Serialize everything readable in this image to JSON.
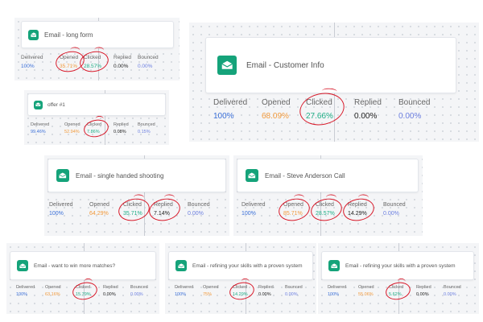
{
  "labels": {
    "delivered": "Delivered",
    "opened": "Opened",
    "clicked": "Clicked",
    "replied": "Replied",
    "bounced": "Bounced"
  },
  "cards": [
    {
      "title": "Email - long form",
      "delivered": "100%",
      "opened": "35.71%",
      "clicked": "28.57%",
      "replied": "0.00%",
      "bounced": "0.00%"
    },
    {
      "title": "offer #1",
      "delivered": "99.46%",
      "opened": "52.94%",
      "clicked": "7.86%",
      "replied": "0.08%",
      "bounced": "0.15%"
    },
    {
      "title": "Email - Customer Info",
      "delivered": "100%",
      "opened": "68.09%",
      "clicked": "27.66%",
      "replied": "0.00%",
      "bounced": "0.00%"
    },
    {
      "title": "Email - single handed shooting",
      "delivered": "100%",
      "opened": "64.29%",
      "clicked": "35.71%",
      "replied": "7.14%",
      "bounced": "0.00%"
    },
    {
      "title": "Email - Steve Anderson Call",
      "delivered": "100%",
      "opened": "85.71%",
      "clicked": "28.57%",
      "replied": "14.29%",
      "bounced": "0.00%"
    },
    {
      "title": "Email - want to win more matches?",
      "delivered": "100%",
      "opened": "63.16%",
      "clicked": "15.79%",
      "replied": "0.00%",
      "bounced": "0.00%"
    },
    {
      "title": "Email - refining your skills with a proven system",
      "delivered": "100%",
      "opened": "75%",
      "clicked": "14.29%",
      "replied": "0.00%",
      "bounced": "0.00%"
    },
    {
      "title": "Email - refining your skills with a proven system",
      "delivered": "100%",
      "opened": "55.06%",
      "clicked": "5.62%",
      "replied": "0.00%",
      "bounced": "0.00%"
    }
  ],
  "colors": {
    "delivered": "#3a6fd8",
    "opened": "#f29a3c",
    "clicked": "#1fae86",
    "replied": "#222222",
    "bounced": "#6c7fe0",
    "icon_bg": "#15a37a",
    "annotation": "#d81a2a"
  },
  "icon_name": "envelope-icon"
}
